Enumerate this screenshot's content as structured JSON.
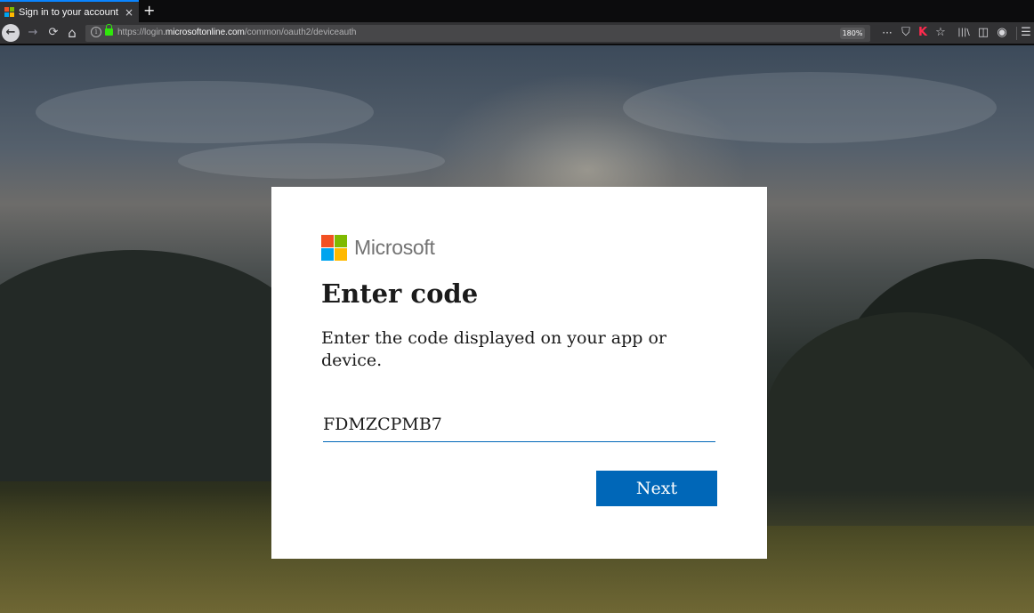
{
  "browser": {
    "tab": {
      "title": "Sign in to your account",
      "close_glyph": "×",
      "favicon": "microsoft-icon"
    },
    "new_tab_glyph": "+",
    "nav": {
      "back_glyph": "←",
      "forward_glyph": "→",
      "reload_glyph": "⟳",
      "home_glyph": "⌂"
    },
    "url": {
      "prefix": "https://login.",
      "domain": "microsoftonline.com",
      "path": "/common/oauth2/deviceauth"
    },
    "zoom": "180%",
    "toolbar_glyphs": {
      "more": "···",
      "pocket": "⛉",
      "extension": "K",
      "bookmark": "☆",
      "library": "|||\\",
      "sidebar": "◫",
      "account": "◉",
      "menu": "☰"
    }
  },
  "card": {
    "brand": "Microsoft",
    "title": "Enter code",
    "description": "Enter the code displayed on your app or device.",
    "code_value": "FDMZCPMB7",
    "next_label": "Next"
  },
  "colors": {
    "accent": "#0067b8",
    "ms_red": "#f25022",
    "ms_green": "#7fba00",
    "ms_blue": "#00a4ef",
    "ms_yellow": "#ffb900"
  }
}
